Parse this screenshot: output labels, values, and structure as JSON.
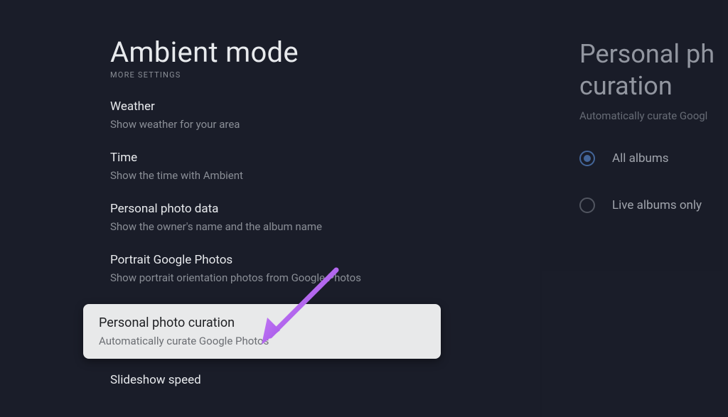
{
  "page": {
    "title": "Ambient mode",
    "section_header": "MORE SETTINGS"
  },
  "settings": [
    {
      "title": "Weather",
      "desc": "Show weather for your area"
    },
    {
      "title": "Time",
      "desc": "Show the time with Ambient"
    },
    {
      "title": "Personal photo data",
      "desc": "Show the owner's name and the album name"
    },
    {
      "title": "Portrait Google Photos",
      "desc": "Show portrait orientation photos from Google Photos"
    },
    {
      "title": "Personal photo curation",
      "desc": "Automatically curate Google Photos"
    },
    {
      "title": "Slideshow speed",
      "desc": ""
    }
  ],
  "detail": {
    "title_line1": "Personal ph",
    "title_line2": "curation",
    "desc": "Automatically curate Googl",
    "options": [
      {
        "label": "All albums",
        "checked": true
      },
      {
        "label": "Live albums only",
        "checked": false
      }
    ]
  }
}
